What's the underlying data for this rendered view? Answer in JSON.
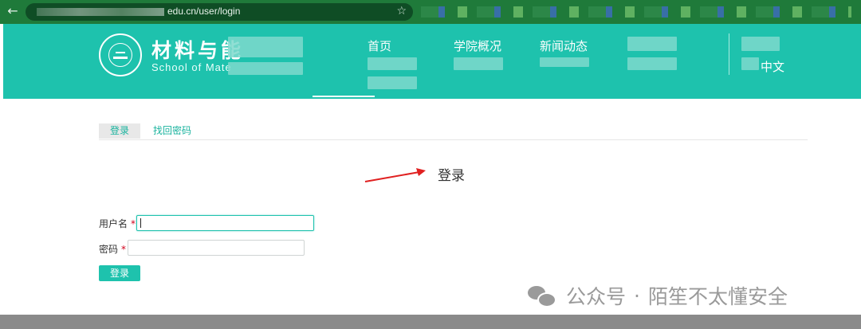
{
  "browser": {
    "back_glyph": "←",
    "url": "edu.cn/user/login",
    "star_glyph": "☆"
  },
  "header": {
    "school_cn": "材料与能",
    "school_en": "School of Mate",
    "nav": {
      "home": "首页",
      "overview": "学院概况",
      "news": "新闻动态",
      "lang": "中文"
    }
  },
  "tabs": {
    "login": "登录",
    "recover": "找回密码"
  },
  "form": {
    "title": "登录",
    "username_label": "用户名",
    "password_label": "密码",
    "required_mark": "*",
    "submit_label": "登录"
  },
  "watermark": {
    "text_a": "公众号",
    "separator": "·",
    "text_b": "陌笙不太懂安全"
  },
  "colors": {
    "accent": "#1ec2ad",
    "browser_frame": "#1f7a3a",
    "arrow": "#e02020",
    "required": "#d0021b"
  }
}
